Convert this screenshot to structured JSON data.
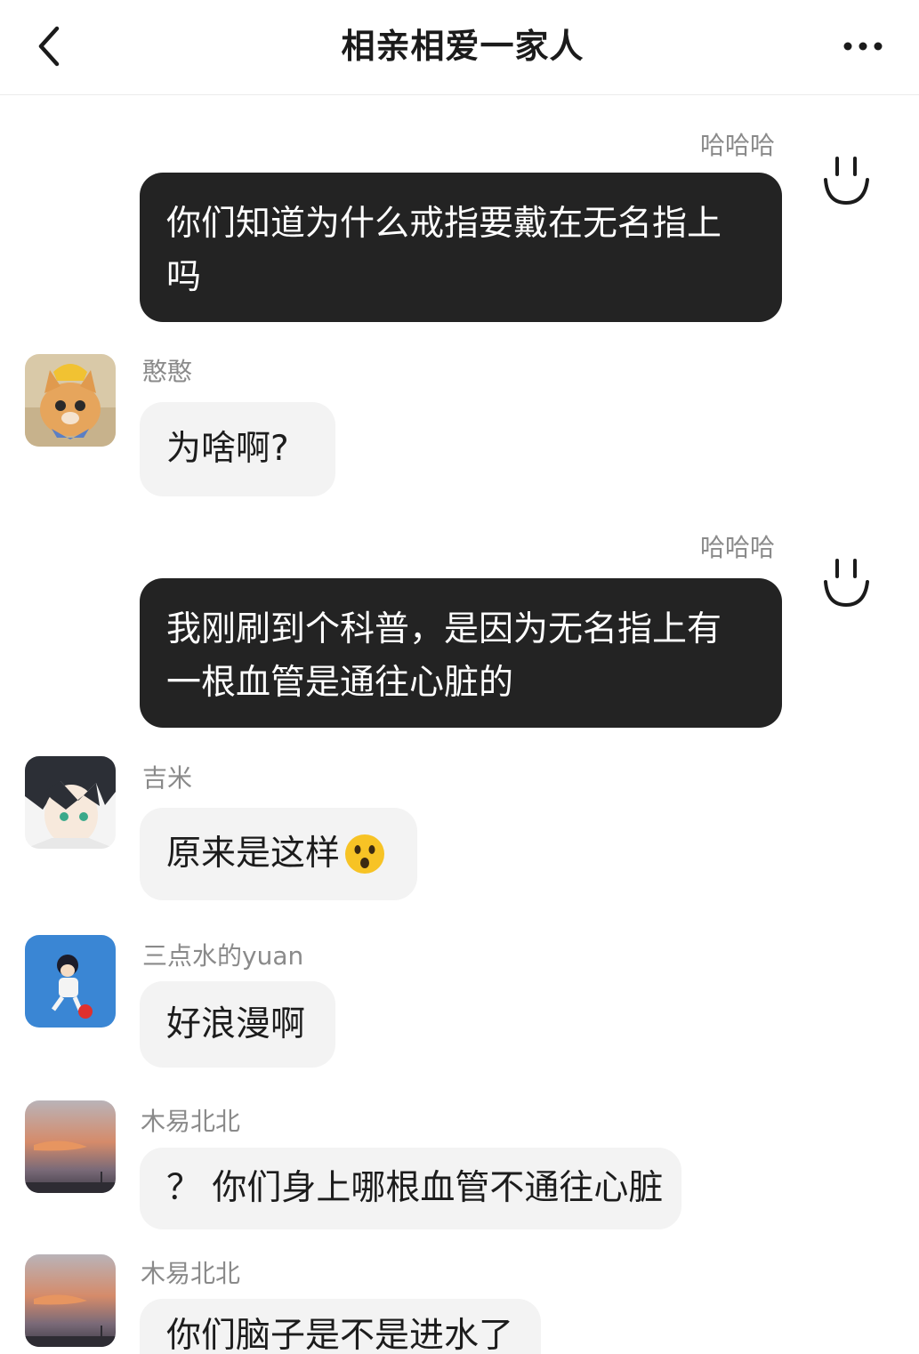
{
  "header": {
    "title": "相亲相爱一家人"
  },
  "messages": [
    {
      "sender": "哈哈哈",
      "text_line1": "你们知道为什么戒指要戴在无名指上",
      "text_line2": "吗"
    },
    {
      "sender": "憨憨",
      "text": "为啥啊?"
    },
    {
      "sender": "哈哈哈",
      "text_line1": "我刚刷到个科普，是因为无名指上有",
      "text_line2": "一根血管是通往心脏的"
    },
    {
      "sender": "吉米",
      "text": "原来是这样",
      "emoji": "😯"
    },
    {
      "sender": "三点水的yuan",
      "text": "好浪漫啊"
    },
    {
      "sender": "木易北北",
      "text": "？ 你们身上哪根血管不通往心脏"
    },
    {
      "sender": "木易北北",
      "text": "你们脑子是不是进水了"
    }
  ],
  "icons": {
    "back": "chevron-left-icon",
    "more": "more-horizontal-icon",
    "self_avatar": "smiley-face-icon"
  },
  "colors": {
    "self_bubble": "#232323",
    "other_bubble": "#f3f3f3",
    "sender_name": "#8a8a8a"
  }
}
